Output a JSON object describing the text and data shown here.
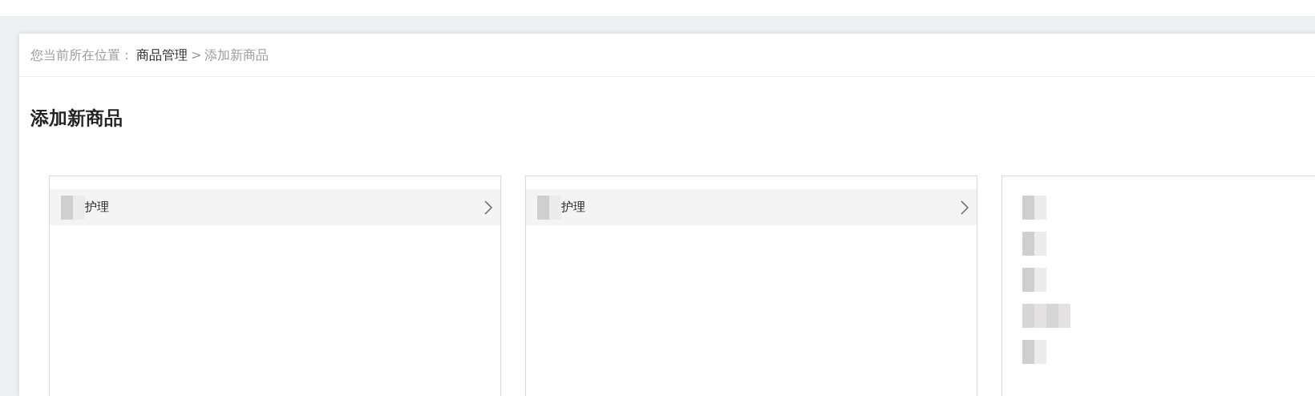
{
  "breadcrumb": {
    "label": "您当前所在位置：",
    "items": [
      {
        "text": "商品管理",
        "kind": "link"
      },
      {
        "text": "添加新商品",
        "kind": "current"
      }
    ],
    "separator": ">"
  },
  "title": "添加新商品",
  "columns": [
    {
      "items": [
        {
          "kind": "category",
          "label": "护理",
          "selected": true,
          "has_children": true
        }
      ]
    },
    {
      "items": [
        {
          "kind": "category",
          "label": "护理",
          "selected": true,
          "has_children": true
        }
      ]
    },
    {
      "items": [
        {
          "kind": "redacted"
        },
        {
          "kind": "redacted"
        },
        {
          "kind": "redacted"
        },
        {
          "kind": "redacted"
        },
        {
          "kind": "redacted"
        }
      ]
    }
  ]
}
